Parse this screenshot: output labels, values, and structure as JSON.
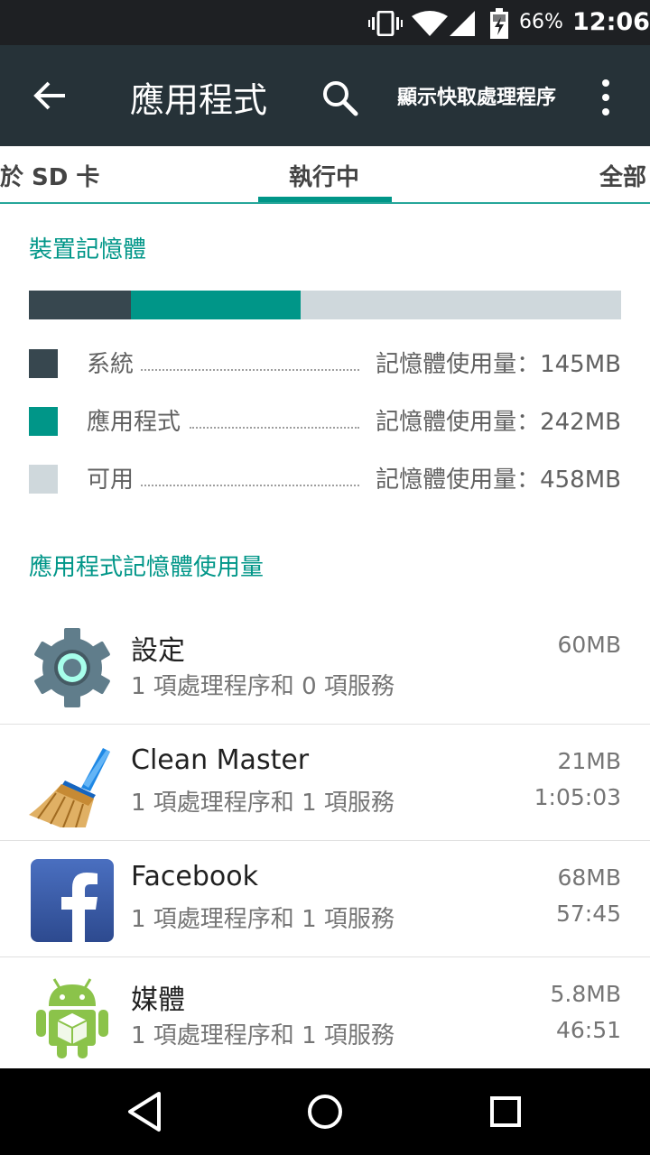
{
  "status_bar": {
    "battery_percent": "66%",
    "time": "12:06"
  },
  "app_bar": {
    "title": "應用程式",
    "show_cached_label": "顯示快取處理程序",
    "icons": [
      "back-arrow-icon",
      "search-icon",
      "more-vert-icon"
    ]
  },
  "tabs": [
    {
      "label": "於 SD 卡"
    },
    {
      "label": "執行中",
      "selected": true
    },
    {
      "label": "全部"
    }
  ],
  "device_memory": {
    "header": "裝置記憶體",
    "legend": [
      {
        "label": "系統",
        "value": "記憶體使用量：145MB",
        "mb": 145,
        "color": "#37474f"
      },
      {
        "label": "應用程式",
        "value": "記憶體使用量：242MB",
        "mb": 242,
        "color": "#009688"
      },
      {
        "label": "可用",
        "value": "記憶體使用量：458MB",
        "mb": 458,
        "color": "#cfd8dc"
      }
    ]
  },
  "app_memory": {
    "header": "應用程式記憶體使用量",
    "apps": [
      {
        "name": "設定",
        "details": "1 項處理程序和 0 項服務",
        "size": "60MB",
        "time": "",
        "icon": "settings-gear-icon"
      },
      {
        "name": "Clean Master",
        "details": "1 項處理程序和 1 項服務",
        "size": "21MB",
        "time": "1:05:03",
        "icon": "broom-icon"
      },
      {
        "name": "Facebook",
        "details": "1 項處理程序和 1 項服務",
        "size": "68MB",
        "time": "57:45",
        "icon": "facebook-icon"
      },
      {
        "name": "媒體",
        "details": "1 項處理程序和 1 項服務",
        "size": "5.8MB",
        "time": "46:51",
        "icon": "android-media-icon"
      }
    ]
  },
  "nav_bar": {
    "icons": [
      "nav-back-icon",
      "nav-home-icon",
      "nav-recents-icon"
    ]
  },
  "colors": {
    "accent": "#009688",
    "app_bar": "#263238",
    "status_bar": "#1e2023"
  }
}
